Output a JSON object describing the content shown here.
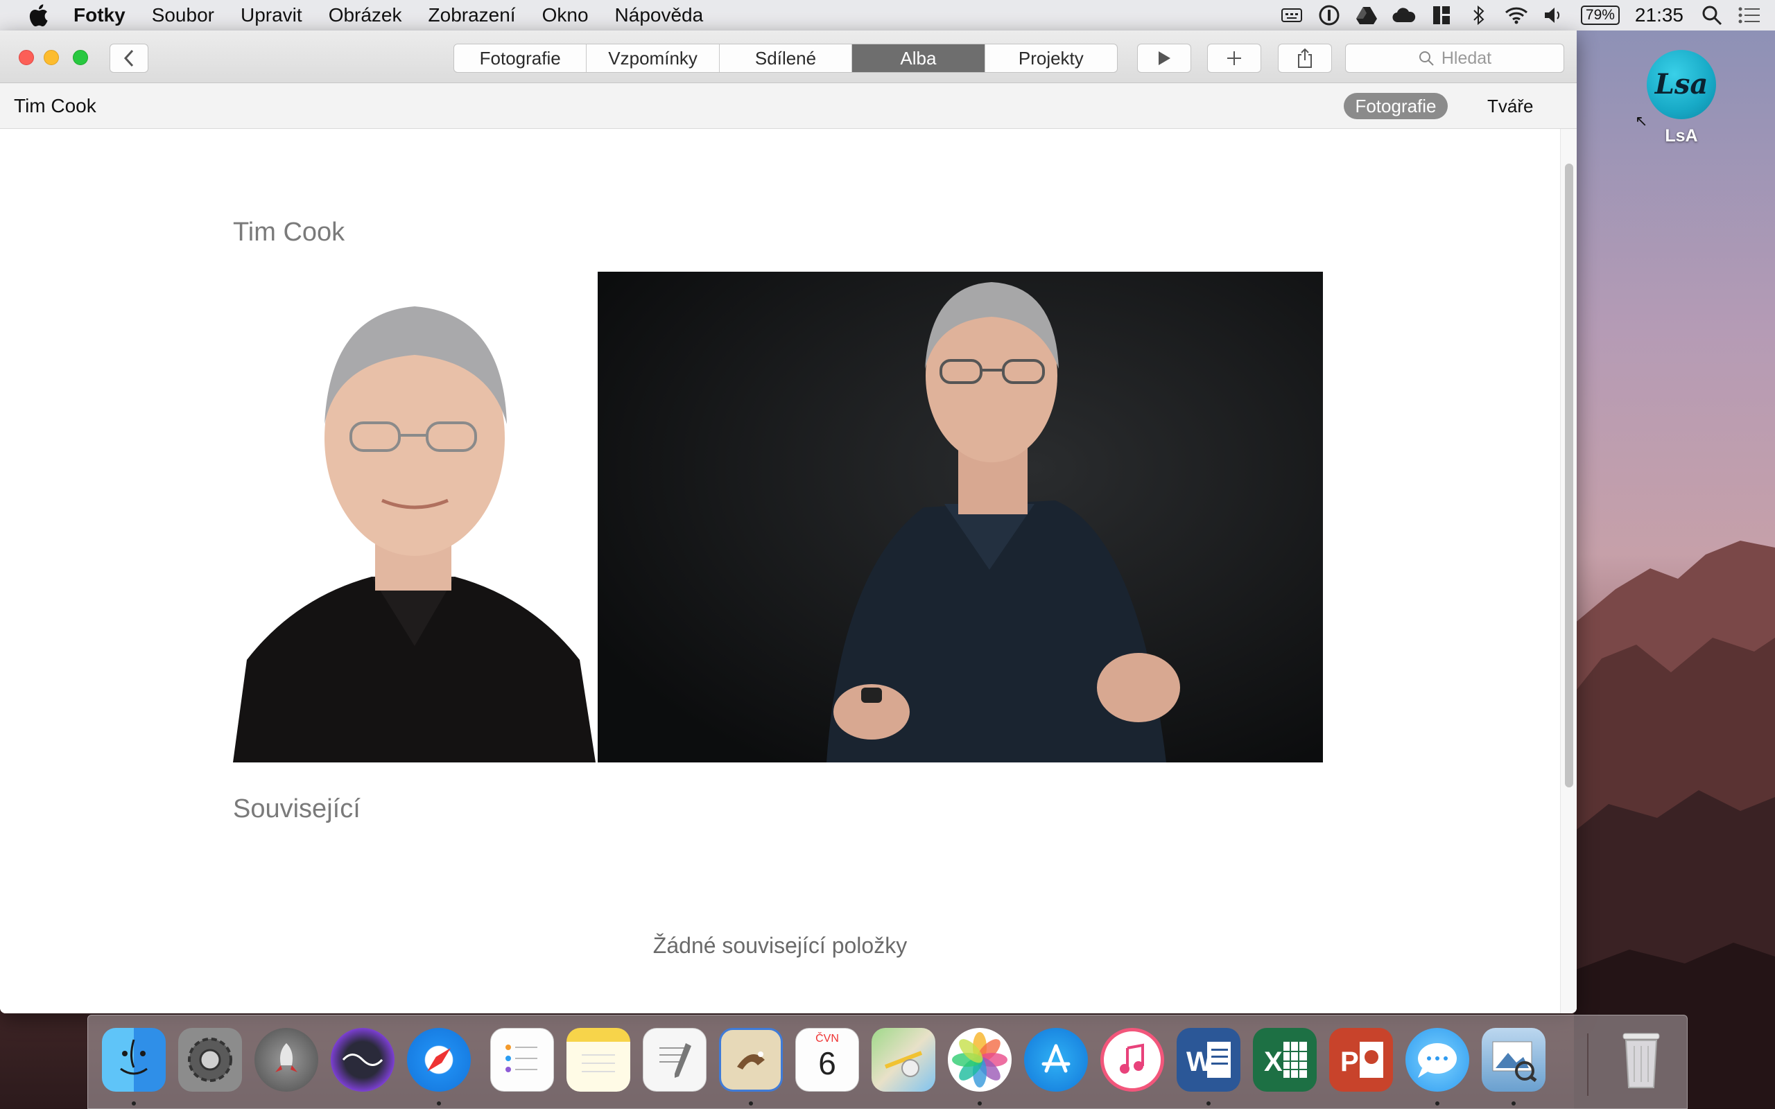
{
  "menubar": {
    "apple_icon": "apple-logo-icon",
    "app_name": "Fotky",
    "menus": [
      "Soubor",
      "Upravit",
      "Obrázek",
      "Zobrazení",
      "Okno",
      "Nápověda"
    ],
    "tray_icons": [
      "keyboard-monitor-icon",
      "onepassword-icon",
      "google-drive-icon",
      "onedrive-cloud-icon",
      "tiling-layout-icon",
      "bluetooth-icon",
      "wifi-icon",
      "volume-icon"
    ],
    "battery": "79%",
    "clock": "21:35",
    "right_icons": [
      "spotlight-search-icon",
      "notification-center-icon"
    ]
  },
  "desktop": {
    "icon_label": "LsA",
    "icon_logo_text": "Lsa"
  },
  "window": {
    "toolbar": {
      "tabs": [
        {
          "label": "Fotografie",
          "active": false
        },
        {
          "label": "Vzpomínky",
          "active": false
        },
        {
          "label": "Sdílené",
          "active": false
        },
        {
          "label": "Alba",
          "active": true
        },
        {
          "label": "Projekty",
          "active": false
        }
      ],
      "search_placeholder": "Hledat"
    },
    "subbar": {
      "album_name": "Tim Cook",
      "view_photos": "Fotografie",
      "view_faces": "Tváře"
    },
    "content": {
      "album_title": "Tim Cook",
      "related_title": "Související",
      "empty_related": "Žádné související položky"
    }
  },
  "dock": {
    "apps": [
      {
        "name": "finder",
        "running": true
      },
      {
        "name": "system-preferences",
        "running": false
      },
      {
        "name": "launchpad",
        "running": false
      },
      {
        "name": "siri",
        "running": false
      },
      {
        "name": "safari",
        "running": true
      },
      {
        "name": "reminders",
        "running": false
      },
      {
        "name": "notes",
        "running": false
      },
      {
        "name": "textedit",
        "running": false
      },
      {
        "name": "mail",
        "running": true
      },
      {
        "name": "calendar",
        "running": false
      },
      {
        "name": "maps",
        "running": false
      },
      {
        "name": "photos",
        "running": true
      },
      {
        "name": "app-store",
        "running": false
      },
      {
        "name": "itunes",
        "running": false
      },
      {
        "name": "microsoft-word",
        "running": true
      },
      {
        "name": "microsoft-excel",
        "running": false
      },
      {
        "name": "microsoft-powerpoint",
        "running": false
      },
      {
        "name": "messages",
        "running": true
      },
      {
        "name": "preview",
        "running": true
      },
      {
        "name": "trash",
        "running": false
      }
    ],
    "calendar_month": "ČVN",
    "calendar_day": "6"
  }
}
